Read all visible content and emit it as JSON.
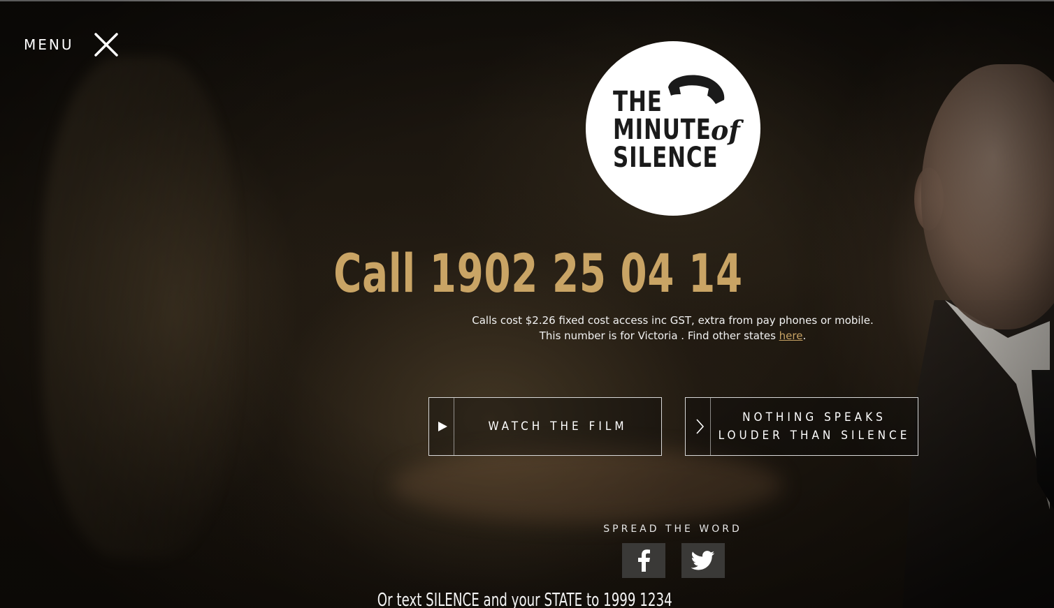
{
  "menu": {
    "label": "MENU"
  },
  "logo": {
    "line1": "THE",
    "line2": "MINUTE",
    "of": "of",
    "line3": "SILENCE",
    "icon": "phone-icon"
  },
  "call": {
    "headline": "Call 1902 25 04 14",
    "cost_text": "Calls cost $2.26 fixed cost access inc GST, extra from pay phones or mobile.",
    "state_prefix": "This number is for Victoria . Find other states ",
    "state_link": "here",
    "state_suffix": "."
  },
  "buttons": {
    "watch_film": "WATCH THE FILM",
    "speaks_line1": "NOTHING SPEAKS",
    "speaks_line2": "LOUDER THAN SILENCE"
  },
  "share": {
    "label": "SPREAD THE WORD",
    "facebook_icon": "facebook-icon",
    "twitter_icon": "twitter-icon"
  },
  "sms": {
    "text": "Or text SILENCE and your STATE to 1999 1234"
  },
  "colors": {
    "accent_gold": "#c9a465",
    "logo_bg": "#ffffff",
    "social_bg": "#3a3937"
  }
}
